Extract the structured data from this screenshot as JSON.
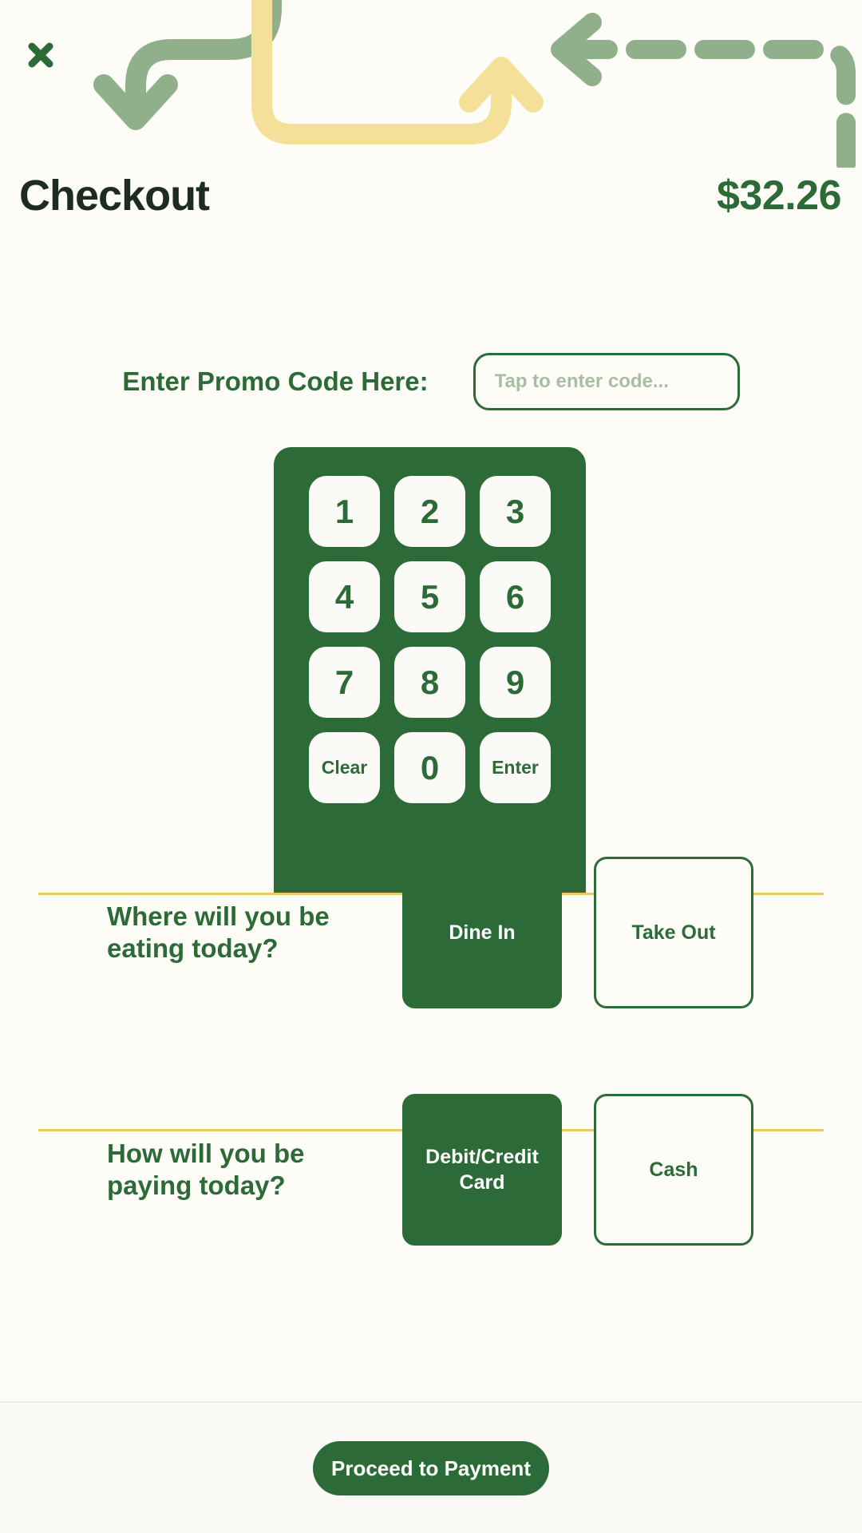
{
  "colors": {
    "background": "#fdfcf7",
    "brand_green": "#2c6b37",
    "sage_green": "#8fb08a",
    "accent_yellow": "#f5e09a",
    "divider_yellow": "#efc75e",
    "title_dark": "#1d2b22",
    "placeholder_muted": "#a9bda4"
  },
  "header": {
    "close_icon": "close-x-icon",
    "title": "Checkout",
    "order_total": "$32.26"
  },
  "decoration": {
    "down_arrow_icon": "arrow-down-curved-icon",
    "up_arrow_icon": "arrow-up-curved-icon",
    "left_dashed_arrow_icon": "arrow-left-dashed-icon"
  },
  "promo": {
    "label": "Enter Promo Code Here:",
    "placeholder": "Tap to enter code...",
    "value": ""
  },
  "keypad": {
    "rows": [
      [
        "1",
        "2",
        "3"
      ],
      [
        "4",
        "5",
        "6"
      ],
      [
        "7",
        "8",
        "9"
      ],
      [
        "Clear",
        "0",
        "Enter"
      ]
    ]
  },
  "dining": {
    "question": "Where will you be eating today?",
    "options": [
      {
        "label": "Dine In",
        "selected": true
      },
      {
        "label": "Take Out",
        "selected": false
      }
    ]
  },
  "payment": {
    "question": "How will you be paying today?",
    "options": [
      {
        "label": "Debit/Credit Card",
        "selected": true
      },
      {
        "label": "Cash",
        "selected": false
      }
    ]
  },
  "footer": {
    "proceed_label": "Proceed to Payment"
  }
}
